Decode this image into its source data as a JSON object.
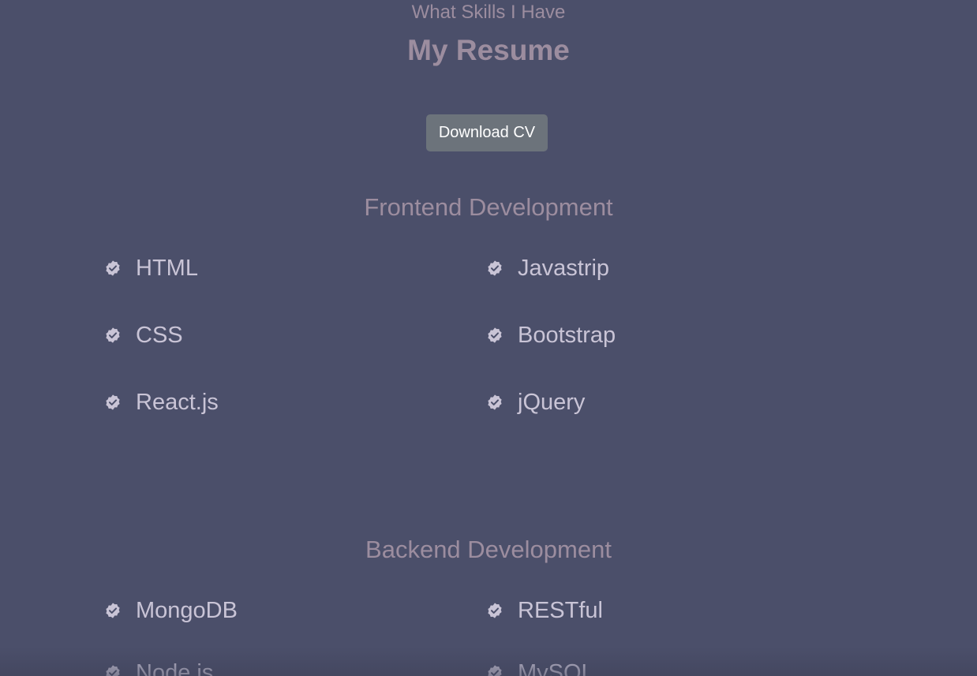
{
  "header": {
    "kicker": "What Skills I Have",
    "title": "My Resume"
  },
  "download_button": {
    "label": "Download CV"
  },
  "colors": {
    "background": "#4b4f6a",
    "heading": "#9c8d9f",
    "skill_text": "#c9c4d6",
    "button_bg": "#6c737b"
  },
  "sections": [
    {
      "title": "Frontend Development",
      "skills": [
        "HTML",
        "Javastrip",
        "CSS",
        "Bootstrap",
        "React.js",
        "jQuery"
      ]
    },
    {
      "title": "Backend Development",
      "skills": [
        "MongoDB",
        "RESTful",
        "Node.js",
        "MySQL"
      ]
    }
  ],
  "icon": "verified-badge-icon"
}
